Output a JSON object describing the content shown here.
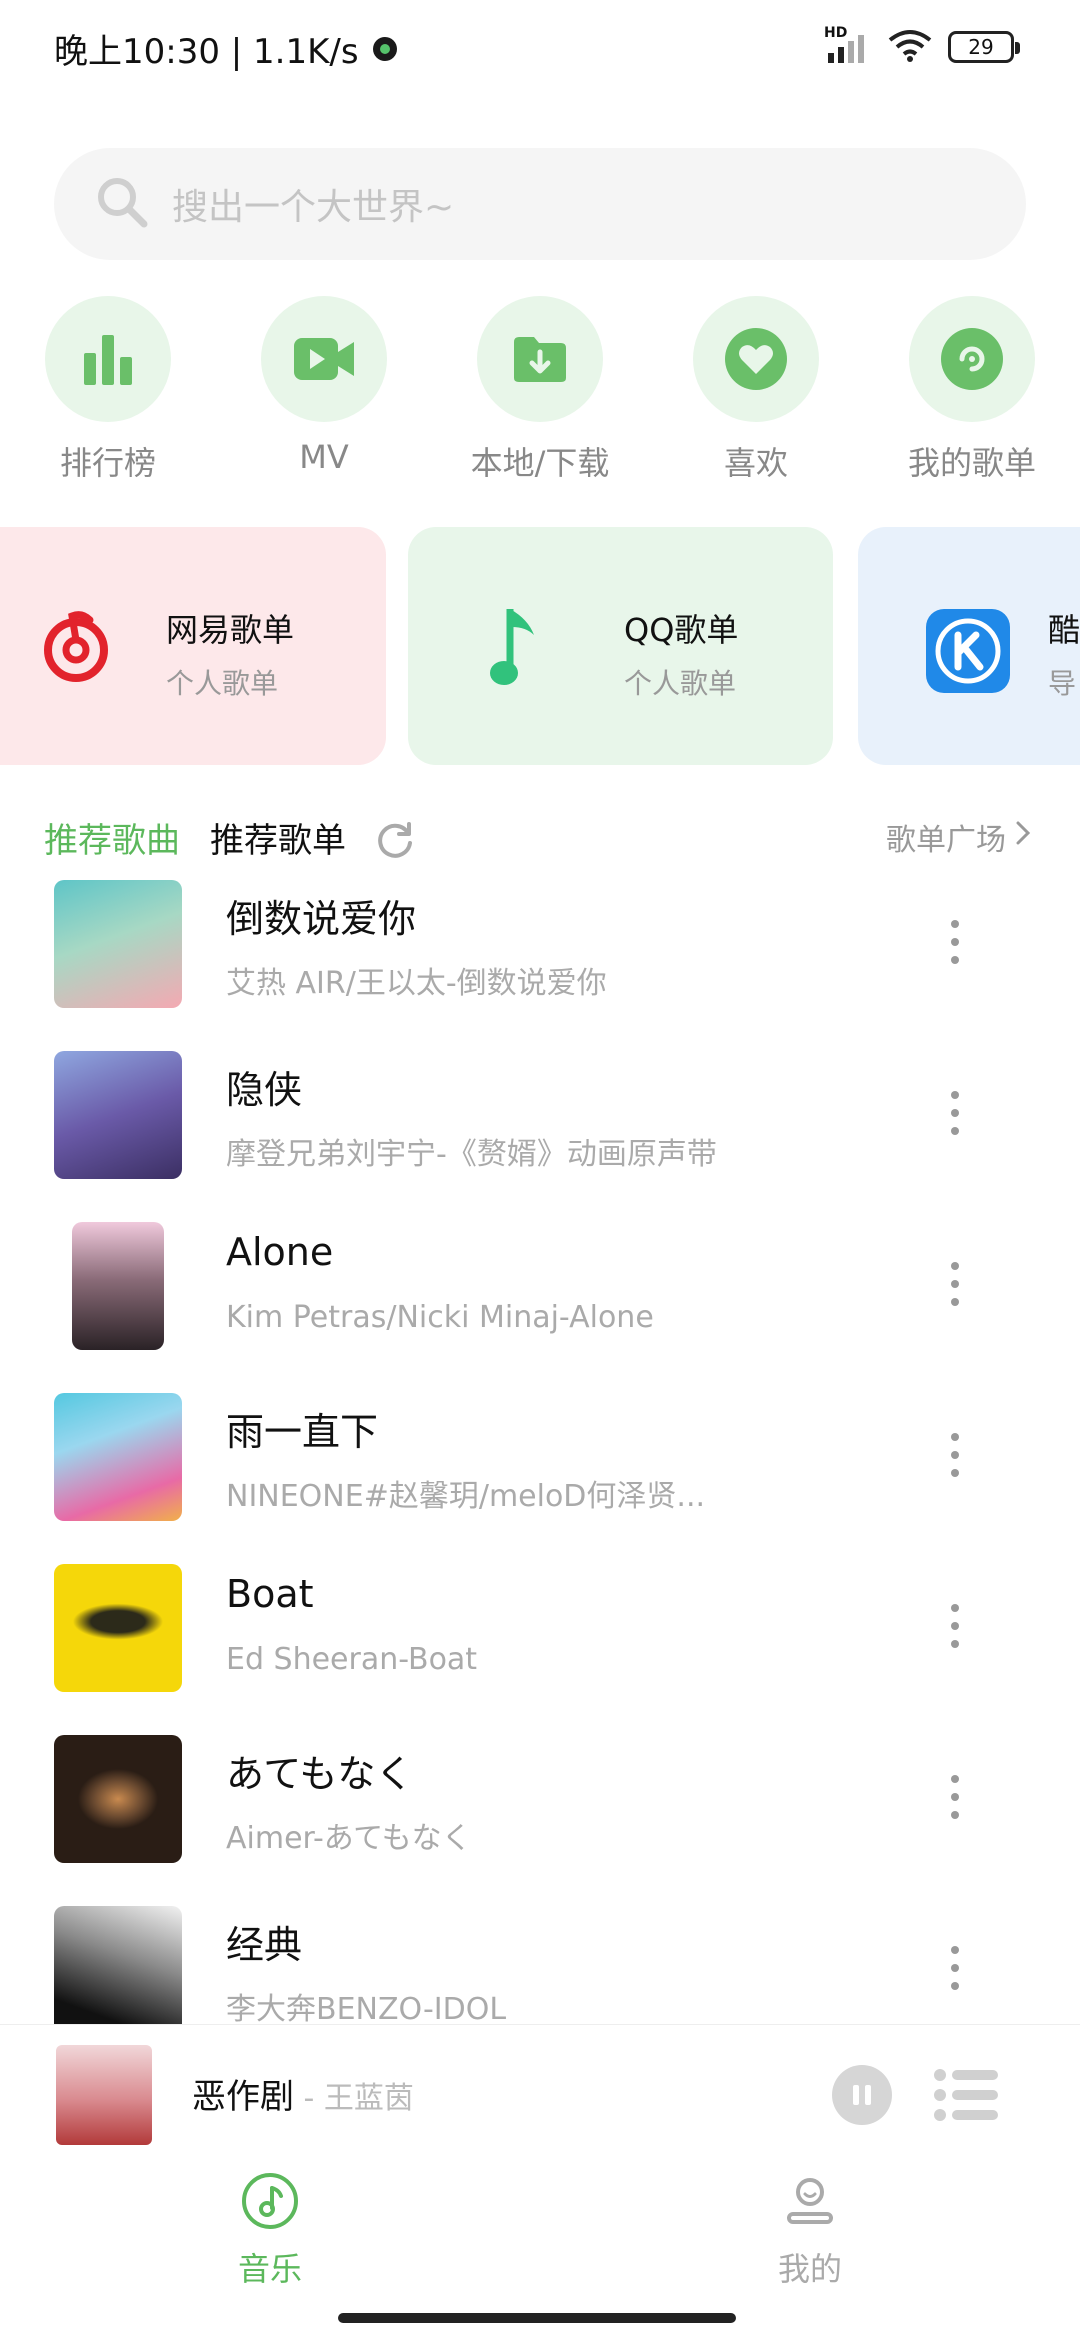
{
  "status_bar": {
    "time_speed": "晚上10:30 | 1.1K/s",
    "network_label": "HD",
    "battery_level": "29"
  },
  "search": {
    "placeholder": "搜出一个大世界~",
    "icon": "search-icon"
  },
  "quick_actions": [
    {
      "label": "排行榜",
      "icon": "chart-bars-icon"
    },
    {
      "label": "MV",
      "icon": "video-camera-icon"
    },
    {
      "label": "本地/下载",
      "icon": "folder-download-icon"
    },
    {
      "label": "喜欢",
      "icon": "heart-icon"
    },
    {
      "label": "我的歌单",
      "icon": "disc-icon"
    }
  ],
  "platform_cards": [
    {
      "title": "网易歌单",
      "subtitle": "个人歌单",
      "icon": "netease-logo-icon",
      "bg_color": "#fde8ea",
      "icon_color": "#e2232c"
    },
    {
      "title": "QQ歌单",
      "subtitle": "个人歌单",
      "icon": "qq-music-logo-icon",
      "bg_color": "#e8f6ea",
      "icon_color": "#31c27c"
    },
    {
      "title": "酷",
      "subtitle": "导",
      "icon": "kugou-logo-icon",
      "bg_color": "#e8f1fb",
      "icon_color": "#2089e8"
    }
  ],
  "section": {
    "tab_recommended_songs": "推荐歌曲",
    "tab_recommended_playlists": "推荐歌单",
    "playlist_plaza": "歌单广场"
  },
  "songs": [
    {
      "title": "倒数说爱你",
      "subtitle": "艾热 AIR/王以太-倒数说爱你",
      "cover_colors": [
        "#5ec5c7",
        "#f4a9b2"
      ]
    },
    {
      "title": "隐侠",
      "subtitle": "摩登兄弟刘宇宁-《赘婿》动画原声带",
      "cover_colors": [
        "#3b2f63",
        "#8fa7e0"
      ]
    },
    {
      "title": "Alone",
      "subtitle": "Kim Petras/Nicki Minaj-Alone",
      "cover_colors": [
        "#f0c9dc",
        "#2a2226"
      ]
    },
    {
      "title": "雨一直下",
      "subtitle": "NINEONE#赵馨玥/meloD何泽贤...",
      "cover_colors": [
        "#54c8e0",
        "#e86aa6"
      ]
    },
    {
      "title": "Boat",
      "subtitle": "Ed Sheeran-Boat",
      "cover_colors": [
        "#f5d70a",
        "#2c2a1a"
      ]
    },
    {
      "title": "あてもなく",
      "subtitle": "Aimer-あてもなく",
      "cover_colors": [
        "#2a1d15",
        "#c98a4f"
      ]
    },
    {
      "title": "经典",
      "subtitle": "李大奔BENZO-IDOL",
      "cover_colors": [
        "#f2f2f2",
        "#111111"
      ]
    }
  ],
  "player": {
    "title": "恶作剧",
    "artist": " - 王蓝茵",
    "cover_colors": [
      "#f1d7d9",
      "#b23a3a"
    ]
  },
  "bottom_nav": [
    {
      "label": "音乐",
      "icon": "music-disc-icon",
      "active": true
    },
    {
      "label": "我的",
      "icon": "profile-icon",
      "active": false
    }
  ],
  "colors": {
    "accent": "#5cb85c",
    "quick_bg": "#e8f6e9",
    "quick_icon": "#6abf69"
  }
}
